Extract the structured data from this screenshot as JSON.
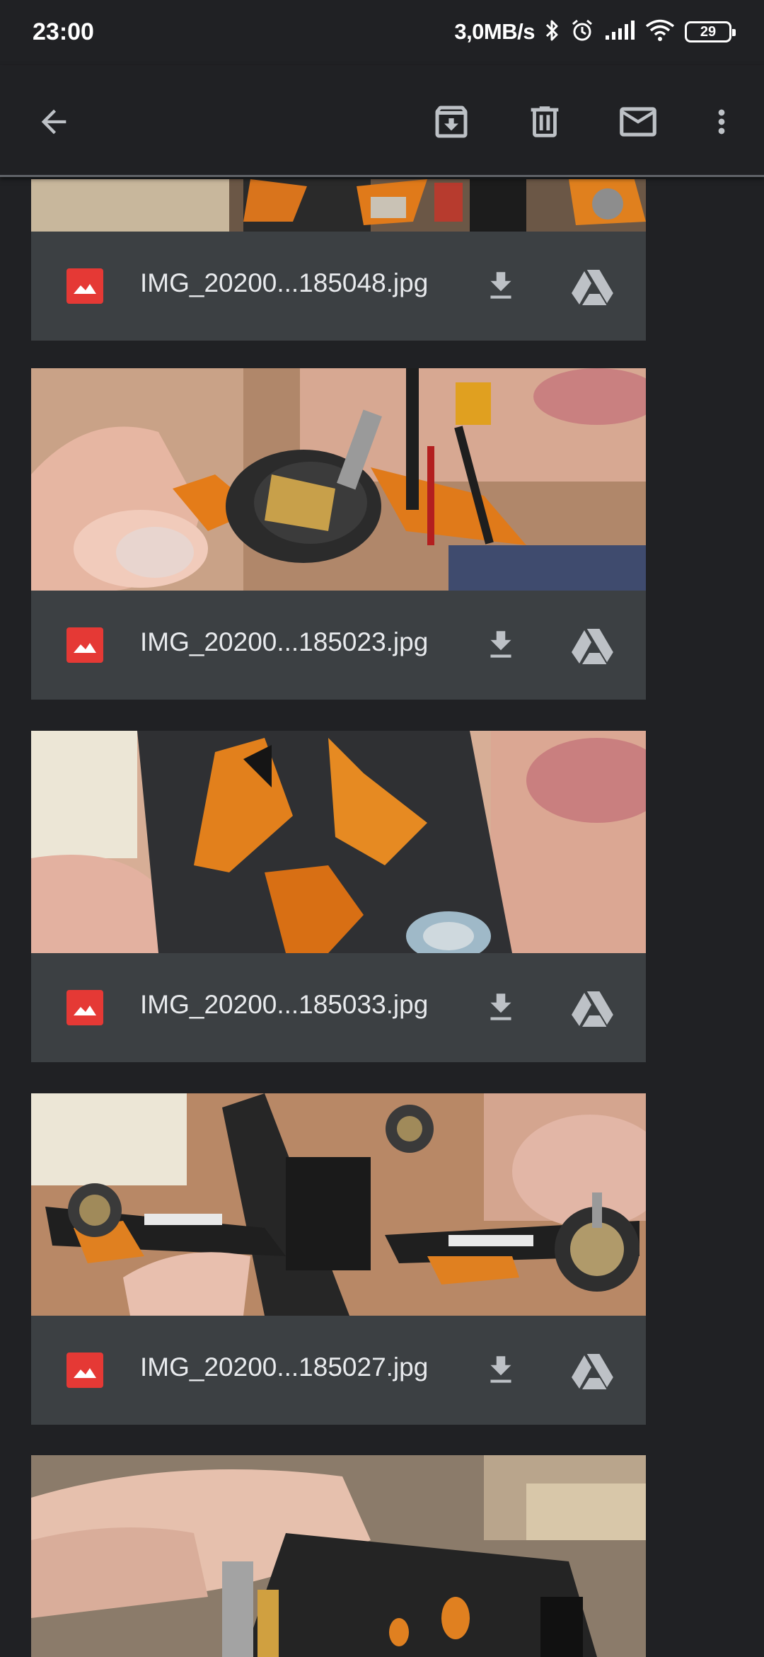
{
  "status_bar": {
    "time": "23:00",
    "network_speed": "3,0MB/s",
    "battery": "29",
    "icons": [
      "bluetooth-icon",
      "alarm-icon",
      "signal-icon",
      "wifi-icon",
      "battery-icon"
    ]
  },
  "toolbar": {
    "icons": [
      "back-arrow-icon",
      "archive-icon",
      "delete-icon",
      "mail-icon",
      "more-vert-icon"
    ]
  },
  "attachments": [
    {
      "filename": "IMG_20200...185048.jpg",
      "photo": "drone-parts-closeup"
    },
    {
      "filename": "IMG_20200...185023.jpg",
      "photo": "motor-in-hand"
    },
    {
      "filename": "IMG_20200...185033.jpg",
      "photo": "carbon-frame-orange-tpu"
    },
    {
      "filename": "IMG_20200...185027.jpg",
      "photo": "assembled-quad-frame"
    },
    {
      "filename": "",
      "photo": "hand-holding-frame"
    }
  ],
  "colors": {
    "background": "#202124",
    "card": "#3c4043",
    "image_file_icon": "#e53935",
    "icon_gray": "#bdc1c6",
    "text": "#e8eaed"
  }
}
